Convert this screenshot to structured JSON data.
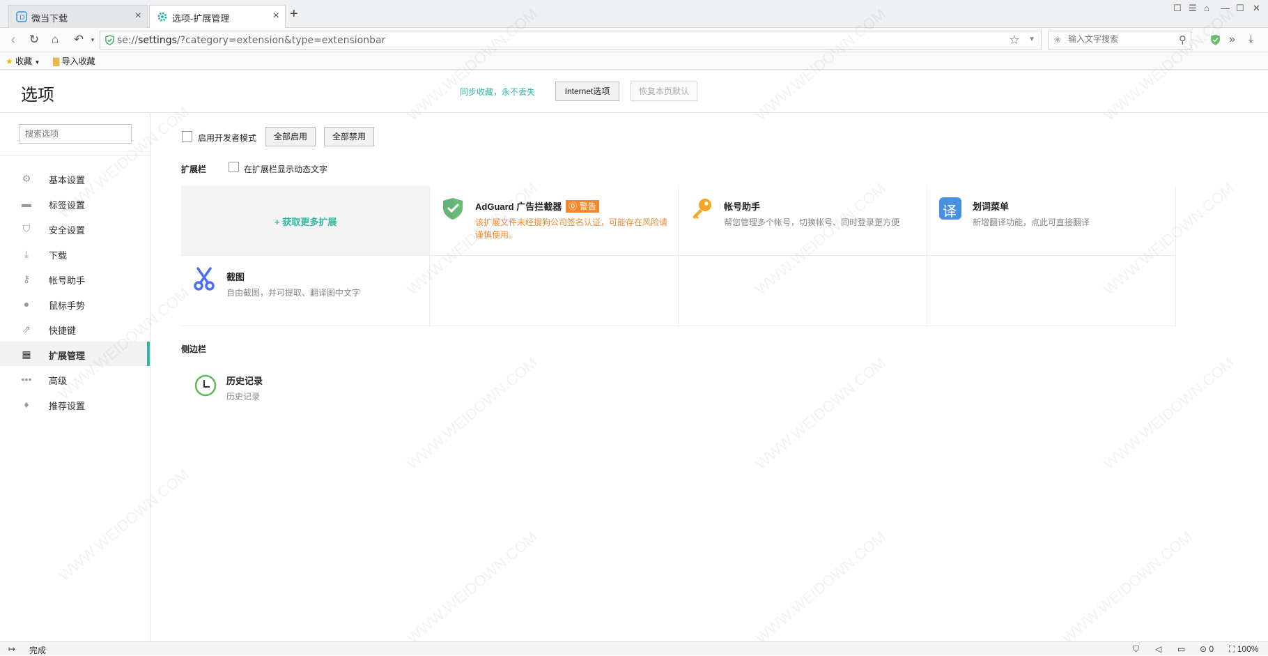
{
  "tabs": [
    {
      "title": "微当下载",
      "active": false
    },
    {
      "title": "选项-扩展管理",
      "active": true
    }
  ],
  "window_controls": [
    "☰",
    "⊡",
    "—",
    "☐",
    "✕"
  ],
  "nav": {
    "url_prefix": "se://",
    "url_host": "settings",
    "url_rest": "/?category=extension&type=extensionbar",
    "search_placeholder": "输入文字搜索"
  },
  "bookmarks": {
    "favorites_label": "收藏",
    "import_label": "导入收藏"
  },
  "header": {
    "title": "选项",
    "sync_text": "同步收藏，永不丢失",
    "internet_options": "Internet选项",
    "restore_default": "恢复本页默认"
  },
  "sidebar": {
    "search_placeholder": "搜索选项",
    "items": [
      {
        "label": "基本设置",
        "icon": "gear-icon"
      },
      {
        "label": "标签设置",
        "icon": "tab-icon"
      },
      {
        "label": "安全设置",
        "icon": "shield-icon"
      },
      {
        "label": "下载",
        "icon": "download-icon"
      },
      {
        "label": "帐号助手",
        "icon": "key-icon"
      },
      {
        "label": "鼠标手势",
        "icon": "mouse-icon"
      },
      {
        "label": "快捷键",
        "icon": "shortcut-icon"
      },
      {
        "label": "扩展管理",
        "icon": "extensions-icon",
        "active": true
      },
      {
        "label": "高级",
        "icon": "more-icon"
      },
      {
        "label": "推荐设置",
        "icon": "recommend-icon"
      }
    ]
  },
  "main": {
    "dev_mode_label": "启用开发者模式",
    "enable_all": "全部启用",
    "disable_all": "全部禁用",
    "extbar_title": "扩展栏",
    "show_dynamic_label": "在扩展栏显示动态文字",
    "get_more": "+ 获取更多扩展",
    "extensions": [
      {
        "name": "AdGuard 广告拦截器",
        "badge": "⓪ 警告",
        "desc": "该扩展文件未经搜狗公司签名认证，可能存在风险请谨慎使用。",
        "warn": true,
        "icon": "adguard-shield-icon"
      },
      {
        "name": "帐号助手",
        "desc": "帮您管理多个帐号，切换帐号、同时登录更方便",
        "icon": "key-icon"
      },
      {
        "name": "划词菜单",
        "desc": "新增翻译功能，点此可直接翻译",
        "icon": "translate-icon",
        "glyph": "译"
      },
      {
        "name": "截图",
        "desc": "自由截图，并可提取、翻译图中文字",
        "icon": "scissors-icon"
      }
    ],
    "sidebar_title": "侧边栏",
    "history": {
      "name": "历史记录",
      "desc": "历史记录"
    }
  },
  "status": {
    "text": "完成",
    "count": "0",
    "zoom": "100%"
  },
  "watermark": "WWW.WEIDOWN.COM",
  "colors": {
    "accent": "#2fb8a0",
    "warning": "#f0882d"
  }
}
